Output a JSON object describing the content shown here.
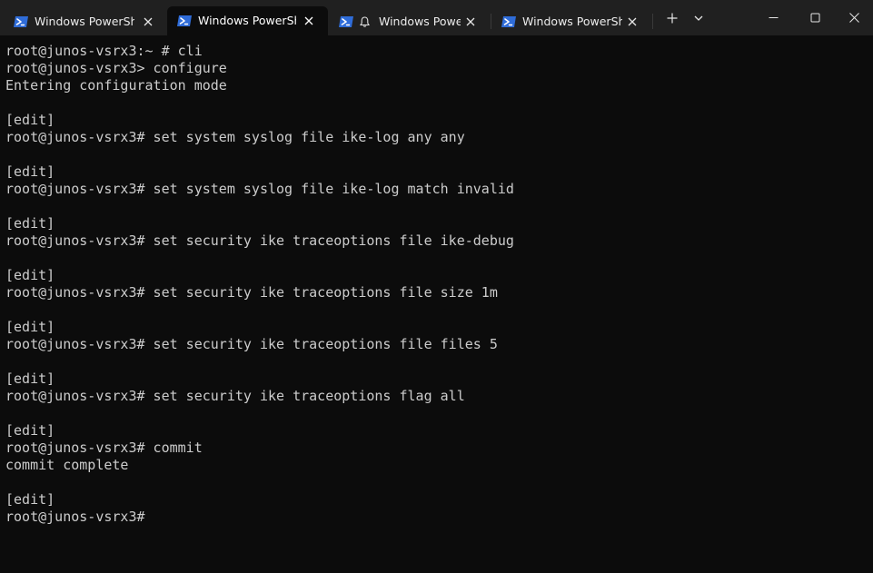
{
  "tabs": [
    {
      "label": "Windows PowerShe",
      "icon": "powershell-icon",
      "active": false,
      "bell": false
    },
    {
      "label": "Windows PowerSh",
      "icon": "powershell-icon",
      "active": true,
      "bell": false
    },
    {
      "label": "Windows Powe",
      "icon": "powershell-icon",
      "active": false,
      "bell": true
    },
    {
      "label": "Windows PowerShe",
      "icon": "powershell-icon",
      "active": false,
      "bell": false
    }
  ],
  "titlebar": {
    "new_tab_icon": "plus-icon",
    "dropdown_icon": "chevron-down-icon",
    "minimize_icon": "minimize-icon",
    "maximize_icon": "maximize-icon",
    "close_icon": "close-icon"
  },
  "colors": {
    "titlebar_bg": "#202020",
    "terminal_bg": "#0c0c0c",
    "terminal_fg": "#cccccc",
    "powershell_blue": "#2f6cd8"
  },
  "terminal": {
    "lines": [
      "root@junos-vsrx3:~ # cli",
      "root@junos-vsrx3> configure",
      "Entering configuration mode",
      "",
      "[edit]",
      "root@junos-vsrx3# set system syslog file ike-log any any",
      "",
      "[edit]",
      "root@junos-vsrx3# set system syslog file ike-log match invalid",
      "",
      "[edit]",
      "root@junos-vsrx3# set security ike traceoptions file ike-debug",
      "",
      "[edit]",
      "root@junos-vsrx3# set security ike traceoptions file size 1m",
      "",
      "[edit]",
      "root@junos-vsrx3# set security ike traceoptions file files 5",
      "",
      "[edit]",
      "root@junos-vsrx3# set security ike traceoptions flag all",
      "",
      "[edit]",
      "root@junos-vsrx3# commit",
      "commit complete",
      "",
      "[edit]",
      "root@junos-vsrx3#"
    ]
  }
}
